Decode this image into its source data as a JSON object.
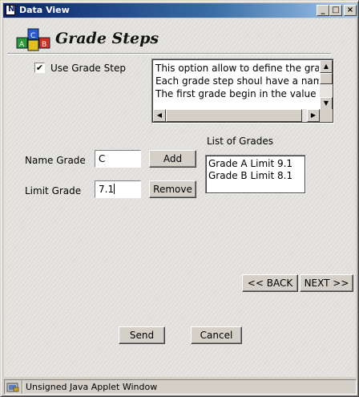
{
  "window": {
    "title": "Data View",
    "controls": {
      "minimize": "_",
      "maximize": "□",
      "close": "×"
    }
  },
  "header": {
    "title": "Grade Steps",
    "logo_icon": "abc-blocks-icon"
  },
  "options": {
    "use_grade_step_label": "Use Grade Step",
    "use_grade_step_checked": true,
    "check_mark": "✔"
  },
  "info_text": {
    "lines": [
      "This option allow to define the grade",
      "Each grade step shoul have a name",
      "The first grade begin in the value zero"
    ],
    "scroll_up": "▲",
    "scroll_down": "▼",
    "scroll_left": "◀",
    "scroll_right": "▶"
  },
  "form": {
    "name_grade_label": "Name Grade",
    "name_grade_value": "C",
    "limit_grade_label": "Limit Grade",
    "limit_grade_value": "7.1",
    "add_label": "Add",
    "remove_label": "Remove"
  },
  "grades": {
    "title": "List of Grades",
    "items": [
      "Grade A Limit 9.1",
      "Grade B Limit 8.1"
    ]
  },
  "navigation": {
    "back_label": "<< BACK",
    "next_label": "NEXT >>"
  },
  "actions": {
    "send_label": "Send",
    "cancel_label": "Cancel"
  },
  "status": {
    "text": "Unsigned Java Applet Window",
    "icon": "applet-lock-icon"
  }
}
